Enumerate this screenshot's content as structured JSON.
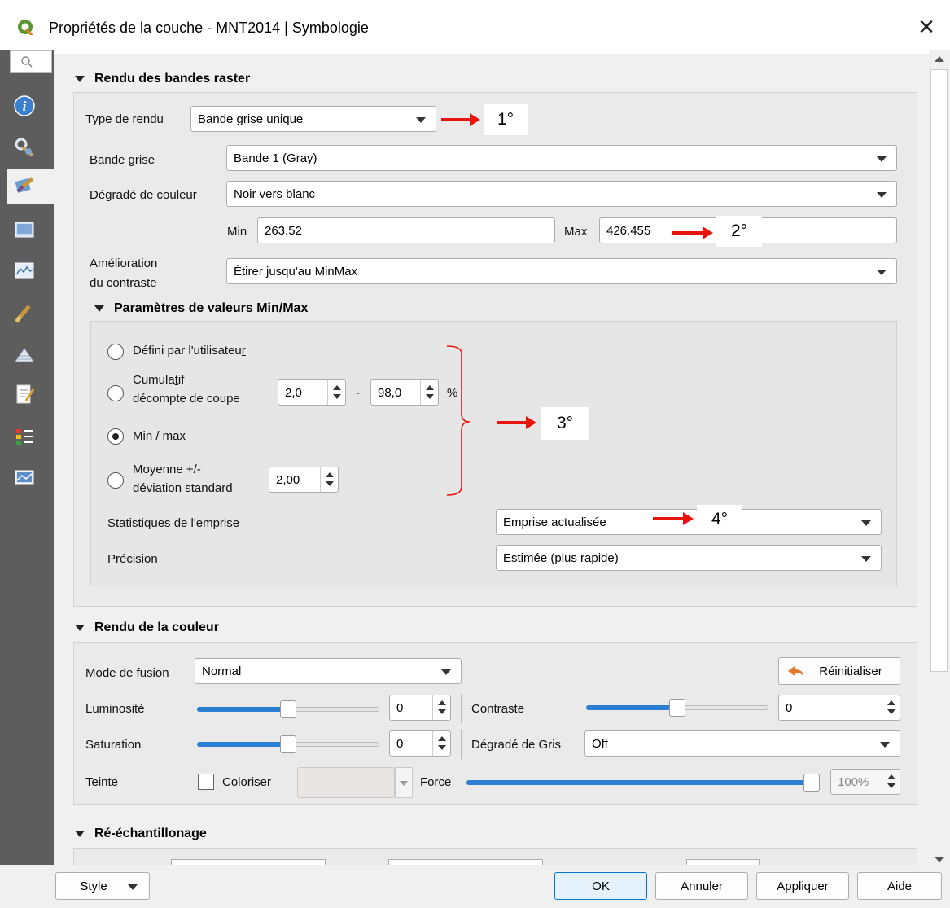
{
  "window": {
    "title": "Propriétés de la couche - MNT2014 | Symbologie",
    "close_glyph": "✕"
  },
  "sidebar": {
    "items": [
      "information-icon",
      "source-icon",
      "symbology-icon",
      "transparency-icon",
      "histogram-icon",
      "rendering-icon",
      "pyramids-icon",
      "metadata-icon",
      "legend-icon",
      "server-icon"
    ]
  },
  "band_render": {
    "header": "Rendu des bandes raster",
    "type_label": "Type de rendu",
    "type_value": "Bande grise unique",
    "gray_band_label": "Bande grise",
    "gray_band_value": "Bande 1 (Gray)",
    "gradient_label": "Dégradé de couleur",
    "gradient_value": "Noir vers blanc",
    "min_label": "Min",
    "min_value": "263.52",
    "max_label": "Max",
    "max_value": "426.455",
    "contrast_label_1": "Amélioration",
    "contrast_label_2": "du contraste",
    "contrast_value": "Étirer jusqu'au MinMax"
  },
  "minmax": {
    "header": "Paramètres de valeurs Min/Max",
    "opt_user_pre": "Défini par l'utilisateu",
    "opt_user_ul": "r",
    "opt_cum_l1_pre": "Cumula",
    "opt_cum_l1_ul": "t",
    "opt_cum_l1_post": "if",
    "opt_cum_l2": "décompte de coupe",
    "cum_low": "2,0",
    "cum_dash": "-",
    "cum_high": "98,0",
    "cum_unit": "%",
    "opt_minmax_ul": "M",
    "opt_minmax_post": "in / max",
    "opt_mean_l1": "Moyenne +/-",
    "opt_mean_l2_pre": "d",
    "opt_mean_l2_ul": "é",
    "opt_mean_l2_post": "viation standard",
    "mean_value": "2,00",
    "extent_label": "Statistiques de l'emprise",
    "extent_value": "Emprise actualisée",
    "precision_label": "Précision",
    "precision_value": "Estimée (plus rapide)"
  },
  "color_render": {
    "header": "Rendu de la couleur",
    "blend_label": "Mode de fusion",
    "blend_value": "Normal",
    "reset_label": "Réinitialiser",
    "brightness_label": "Luminosité",
    "brightness_value": "0",
    "brightness_level": 0.5,
    "contrast_label": "Contraste",
    "contrast_value": "0",
    "contrast_level": 0.5,
    "saturation_label": "Saturation",
    "saturation_value": "0",
    "saturation_level": 0.5,
    "gray_label": "Dégradé de Gris",
    "gray_value": "Off",
    "hue_label": "Teinte",
    "colorize_label": "Coloriser",
    "strength_label": "Force",
    "strength_value": "100%",
    "strength_level": 1.0
  },
  "resample": {
    "header": "Ré-échantillonage"
  },
  "annotations": {
    "a1": "1°",
    "a2": "2°",
    "a3": "3°",
    "a4": "4°"
  },
  "buttons": {
    "style": "Style",
    "ok": "OK",
    "cancel": "Annuler",
    "apply": "Appliquer",
    "help": "Aide"
  },
  "colors": {
    "accent": "#2a7fd4",
    "annotation_red": "#e8140e",
    "reset_icon": "#e8772e"
  }
}
